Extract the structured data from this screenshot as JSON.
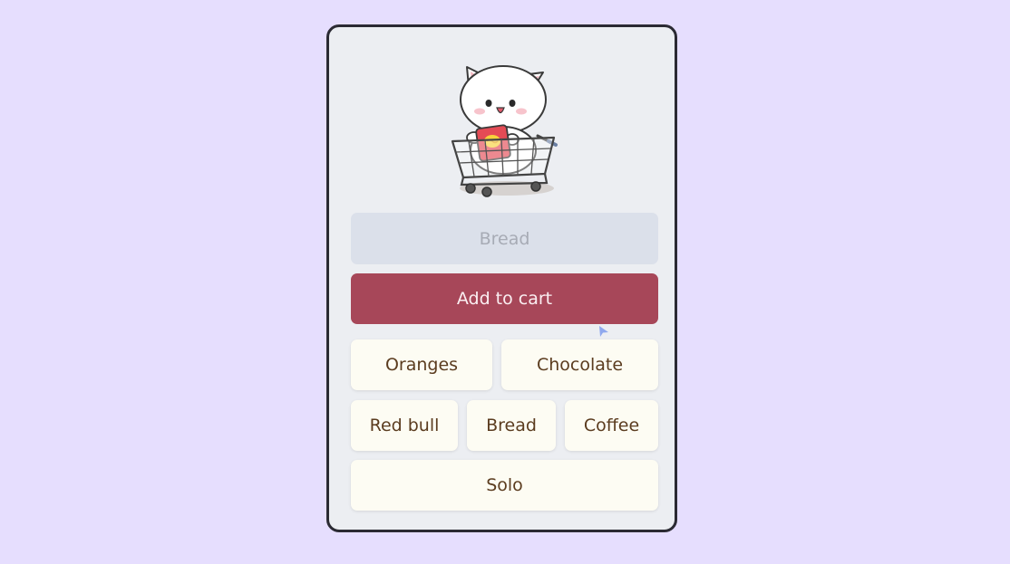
{
  "search": {
    "placeholder": "Bread",
    "value": ""
  },
  "add_button": {
    "label": "Add to cart"
  },
  "items": [
    {
      "label": "Oranges"
    },
    {
      "label": "Chocolate"
    },
    {
      "label": "Red bull"
    },
    {
      "label": "Bread"
    },
    {
      "label": "Coffee"
    },
    {
      "label": "Solo"
    }
  ],
  "mascot": {
    "icon": "cat-in-shopping-cart-illustration"
  },
  "colors": {
    "page_background": "#e6defe",
    "card_background": "#eceef2",
    "card_border": "#2b2a33",
    "input_background": "#dbe0ea",
    "primary_button": "#a74759",
    "item_button": "#fdfcf3",
    "item_text": "#5b3c1f",
    "cursor": "#8fa8ee"
  }
}
